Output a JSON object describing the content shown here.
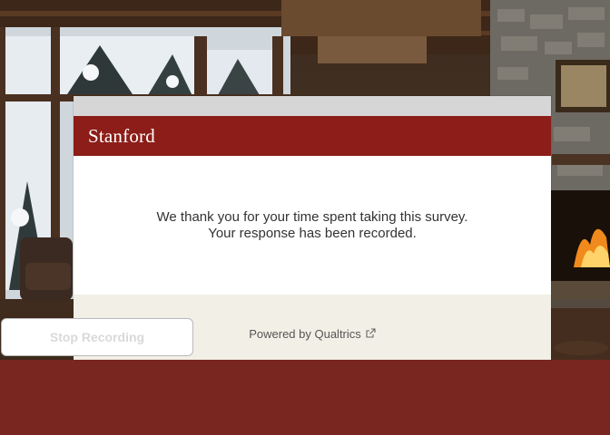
{
  "survey": {
    "brand": "Stanford",
    "message_line1": "We thank you for your time spent taking this survey.",
    "message_line2": "Your response has been recorded.",
    "footer_link": "Powered by Qualtrics"
  },
  "recording": {
    "stop_label": "Stop Recording"
  },
  "colors": {
    "header": "#8c1d18",
    "footer": "#f2efe6",
    "band": "#7a2620"
  },
  "icons": [
    "external-link-icon"
  ]
}
